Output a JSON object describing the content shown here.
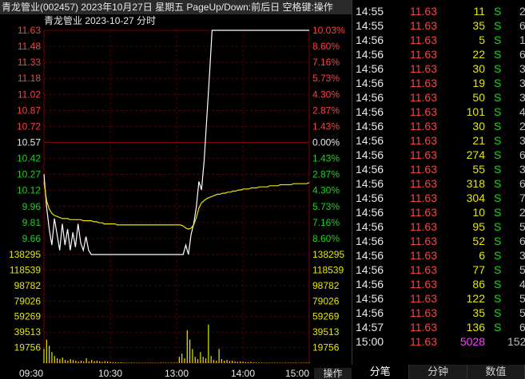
{
  "window": {
    "title": "青龙管业(002457) 2023年10月27日 星期五 PageUp/Down:前后日 空格键:操作"
  },
  "chart_header": {
    "name": "青龙管业",
    "date": "2023-10-27",
    "mode": "分时"
  },
  "colors": {
    "up": "#ff4040",
    "flat": "#e8e8e8",
    "down": "#20d020",
    "price_line": "#ffffff",
    "avg_line": "#e6e600",
    "volume": "#e6e600",
    "grid": "#7a0000",
    "magenta": "#ff40ff"
  },
  "chart_data": [
    {
      "type": "line",
      "x_labels": [
        "09:30",
        "10:30",
        "13:00",
        "14:00",
        "15:00"
      ],
      "prev_close": 10.57,
      "price_ticks": [
        "11.63",
        "11.48",
        "11.33",
        "11.18",
        "11.02",
        "10.87",
        "10.72",
        "10.57",
        "10.42",
        "10.27",
        "10.12",
        "9.96",
        "9.81",
        "9.66"
      ],
      "pct_ticks": [
        "10.03%",
        "8.60%",
        "7.16%",
        "5.73%",
        "4.30%",
        "2.87%",
        "1.43%",
        "0.00%",
        "1.43%",
        "2.87%",
        "4.30%",
        "5.73%",
        "7.16%",
        "8.60%"
      ],
      "ylim": [
        9.51,
        11.63
      ],
      "series": [
        {
          "values": [
            10.27,
            9.96,
            9.75,
            9.6,
            9.85,
            9.7,
            9.55,
            9.8,
            9.6,
            9.75,
            9.55,
            9.72,
            9.58,
            9.8,
            9.62,
            9.55,
            9.68,
            9.55,
            9.51,
            9.51,
            9.51,
            9.51,
            9.51,
            9.51,
            9.51,
            9.51,
            9.51,
            9.51,
            9.51,
            9.51,
            9.51,
            9.51,
            9.51,
            9.51,
            9.51,
            9.51,
            9.51,
            9.51,
            9.51,
            9.51,
            9.51,
            9.51,
            9.51,
            9.51,
            9.51,
            9.51,
            9.51,
            9.51,
            9.51,
            9.51,
            9.51,
            9.51,
            9.51,
            9.51,
            9.6,
            9.51,
            9.7,
            9.8,
            9.96,
            10.2,
            10.12,
            10.4,
            10.8,
            11.2,
            11.63,
            11.63,
            11.63,
            11.63,
            11.63,
            11.63,
            11.63,
            11.63,
            11.63,
            11.63,
            11.63,
            11.63,
            11.63,
            11.63,
            11.63,
            11.63,
            11.63,
            11.63,
            11.63,
            11.63,
            11.63,
            11.63,
            11.63,
            11.63,
            11.63,
            11.63,
            11.63,
            11.63,
            11.63,
            11.63,
            11.63,
            11.63,
            11.63,
            11.63,
            11.63,
            11.63,
            11.63,
            11.63
          ]
        },
        {
          "values": [
            10.2,
            10.02,
            9.94,
            9.9,
            9.88,
            9.87,
            9.86,
            9.85,
            9.85,
            9.85,
            9.84,
            9.84,
            9.84,
            9.84,
            9.84,
            9.83,
            9.83,
            9.83,
            9.83,
            9.82,
            9.82,
            9.81,
            9.81,
            9.8,
            9.8,
            9.8,
            9.8,
            9.8,
            9.79,
            9.79,
            9.79,
            9.79,
            9.79,
            9.79,
            9.79,
            9.79,
            9.79,
            9.79,
            9.79,
            9.79,
            9.79,
            9.79,
            9.79,
            9.79,
            9.79,
            9.79,
            9.79,
            9.79,
            9.79,
            9.79,
            9.79,
            9.79,
            9.79,
            9.78,
            9.76,
            9.75,
            9.76,
            9.79,
            9.86,
            9.95,
            10.0,
            10.02,
            10.04,
            10.05,
            10.06,
            10.07,
            10.08,
            10.08,
            10.09,
            10.09,
            10.1,
            10.1,
            10.11,
            10.11,
            10.12,
            10.12,
            10.13,
            10.13,
            10.13,
            10.14,
            10.14,
            10.14,
            10.15,
            10.15,
            10.15,
            10.15,
            10.16,
            10.16,
            10.16,
            10.16,
            10.17,
            10.17,
            10.17,
            10.17,
            10.17,
            10.18,
            10.18,
            10.18,
            10.18,
            10.18,
            10.18,
            10.19
          ]
        }
      ]
    },
    {
      "type": "bar",
      "vol_ticks": [
        "138295",
        "118539",
        "98782",
        "79026",
        "59269",
        "39513",
        "19756"
      ],
      "ylim": [
        0,
        138295
      ],
      "values": [
        18000,
        30000,
        22000,
        14000,
        9000,
        6000,
        5000,
        7000,
        4000,
        3000,
        5000,
        4000,
        3000,
        2000,
        3000,
        2000,
        6000,
        2000,
        4000,
        2500,
        3000,
        2000,
        1500,
        2500,
        2000,
        1500,
        1200,
        1000,
        800,
        900,
        700,
        600,
        500,
        600,
        500,
        400,
        500,
        400,
        500,
        400,
        600,
        500,
        400,
        500,
        700,
        400,
        500,
        400,
        600,
        700,
        500,
        8000,
        12000,
        6000,
        42000,
        30000,
        18000,
        8000,
        5000,
        14000,
        8000,
        6000,
        49000,
        9000,
        4000,
        3000,
        18000,
        5000,
        3000,
        4000,
        2500,
        3000,
        2000,
        1500,
        2000,
        1800,
        1200,
        1000,
        1500,
        900,
        800,
        700,
        600,
        500,
        600,
        500,
        400,
        500,
        400,
        500,
        400,
        600,
        500,
        400,
        500,
        700,
        400,
        500,
        400,
        600,
        700
      ]
    }
  ],
  "ticks": [
    {
      "time": "14:55",
      "price": "11.63",
      "vol": "11",
      "side": "S",
      "n": "2"
    },
    {
      "time": "14:55",
      "price": "11.63",
      "vol": "35",
      "side": "S",
      "n": "6"
    },
    {
      "time": "14:56",
      "price": "11.63",
      "vol": "5",
      "side": "S",
      "n": "1"
    },
    {
      "time": "14:56",
      "price": "11.63",
      "vol": "22",
      "side": "S",
      "n": "6"
    },
    {
      "time": "14:56",
      "price": "11.63",
      "vol": "30",
      "side": "S",
      "n": "3"
    },
    {
      "time": "14:56",
      "price": "11.63",
      "vol": "19",
      "side": "S",
      "n": "3"
    },
    {
      "time": "14:56",
      "price": "11.63",
      "vol": "50",
      "side": "S",
      "n": "3"
    },
    {
      "time": "14:56",
      "price": "11.63",
      "vol": "101",
      "side": "S",
      "n": "4"
    },
    {
      "time": "14:56",
      "price": "11.63",
      "vol": "30",
      "side": "S",
      "n": "2"
    },
    {
      "time": "14:56",
      "price": "11.63",
      "vol": "21",
      "side": "S",
      "n": "3"
    },
    {
      "time": "14:56",
      "price": "11.63",
      "vol": "274",
      "side": "S",
      "n": "6"
    },
    {
      "time": "14:56",
      "price": "11.63",
      "vol": "55",
      "side": "S",
      "n": "3"
    },
    {
      "time": "14:56",
      "price": "11.63",
      "vol": "318",
      "side": "S",
      "n": "6"
    },
    {
      "time": "14:56",
      "price": "11.63",
      "vol": "304",
      "side": "S",
      "n": "7"
    },
    {
      "time": "14:56",
      "price": "11.63",
      "vol": "10",
      "side": "S",
      "n": "2"
    },
    {
      "time": "14:56",
      "price": "11.63",
      "vol": "95",
      "side": "S",
      "n": "5"
    },
    {
      "time": "14:56",
      "price": "11.63",
      "vol": "52",
      "side": "S",
      "n": "6"
    },
    {
      "time": "14:56",
      "price": "11.63",
      "vol": "6",
      "side": "S",
      "n": "3"
    },
    {
      "time": "14:56",
      "price": "11.63",
      "vol": "77",
      "side": "S",
      "n": "5"
    },
    {
      "time": "14:56",
      "price": "11.63",
      "vol": "86",
      "side": "S",
      "n": "4"
    },
    {
      "time": "14:56",
      "price": "11.63",
      "vol": "122",
      "side": "S",
      "n": "5"
    },
    {
      "time": "14:56",
      "price": "11.63",
      "vol": "35",
      "side": "S",
      "n": "5"
    },
    {
      "time": "14:57",
      "price": "11.63",
      "vol": "136",
      "side": "S",
      "n": "6"
    },
    {
      "time": "15:00",
      "price": "11.63",
      "vol": "5028",
      "side": "",
      "n": "152"
    }
  ],
  "tabs": {
    "fenbi": "分笔",
    "fenzhong": "分钟",
    "shuju": "数值",
    "caozuo": "操作"
  }
}
